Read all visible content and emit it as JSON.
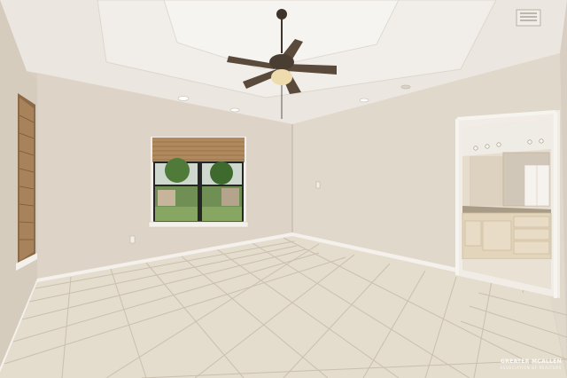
{
  "photo": {
    "room": "empty-bedroom",
    "watermark": {
      "brand": "GREATER MCALLEN",
      "sub": "ASSOCIATION OF REALTORS"
    }
  },
  "icons": {
    "ceiling_fan": "ceiling-fan-icon",
    "vent": "air-vent-icon",
    "window": "window-icon",
    "door": "doorway-icon"
  },
  "colors": {
    "wall": "#dcd3c6",
    "wall_shadow": "#cfc5b6",
    "ceiling": "#ece8e2",
    "floor_tile": "#e4dccd",
    "grout": "#cbbfae",
    "fan_wood": "#5a4a3c",
    "trim": "#f4f1ec",
    "window_frame": "#262626",
    "blind": "#b08a5e",
    "cabinet": "#e3d5bc",
    "countertop": "#a89c87",
    "tree_green": "#4f7a3a"
  }
}
